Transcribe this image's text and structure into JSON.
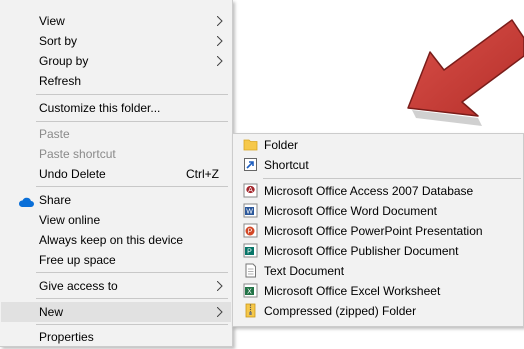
{
  "context_menu": {
    "items": [
      {
        "label": "View"
      },
      {
        "label": "Sort by"
      },
      {
        "label": "Group by"
      },
      {
        "label": "Refresh"
      },
      {
        "label": "Customize this folder..."
      },
      {
        "label": "Paste"
      },
      {
        "label": "Paste shortcut"
      },
      {
        "label": "Undo Delete",
        "shortcut": "Ctrl+Z"
      },
      {
        "label": "Share"
      },
      {
        "label": "View online"
      },
      {
        "label": "Always keep on this device"
      },
      {
        "label": "Free up space"
      },
      {
        "label": "Give access to"
      },
      {
        "label": "New"
      },
      {
        "label": "Properties"
      }
    ]
  },
  "new_submenu": {
    "items": [
      {
        "label": "Folder",
        "icon": "folder-icon"
      },
      {
        "label": "Shortcut",
        "icon": "shortcut-icon"
      },
      {
        "label": "Microsoft Office Access 2007 Database",
        "icon": "access-icon"
      },
      {
        "label": "Microsoft Office Word Document",
        "icon": "word-icon"
      },
      {
        "label": "Microsoft Office PowerPoint Presentation",
        "icon": "powerpoint-icon"
      },
      {
        "label": "Microsoft Office Publisher Document",
        "icon": "publisher-icon"
      },
      {
        "label": "Text Document",
        "icon": "text-document-icon"
      },
      {
        "label": "Microsoft Office Excel Worksheet",
        "icon": "excel-icon"
      },
      {
        "label": "Compressed (zipped) Folder",
        "icon": "zip-folder-icon"
      }
    ]
  },
  "colors": {
    "menu_bg": "#f2f2f2",
    "highlight": "#e1e1e1",
    "disabled_text": "#8a8a8a",
    "arrow_red": "#c9403a",
    "onedrive_blue": "#0a6fd8"
  }
}
